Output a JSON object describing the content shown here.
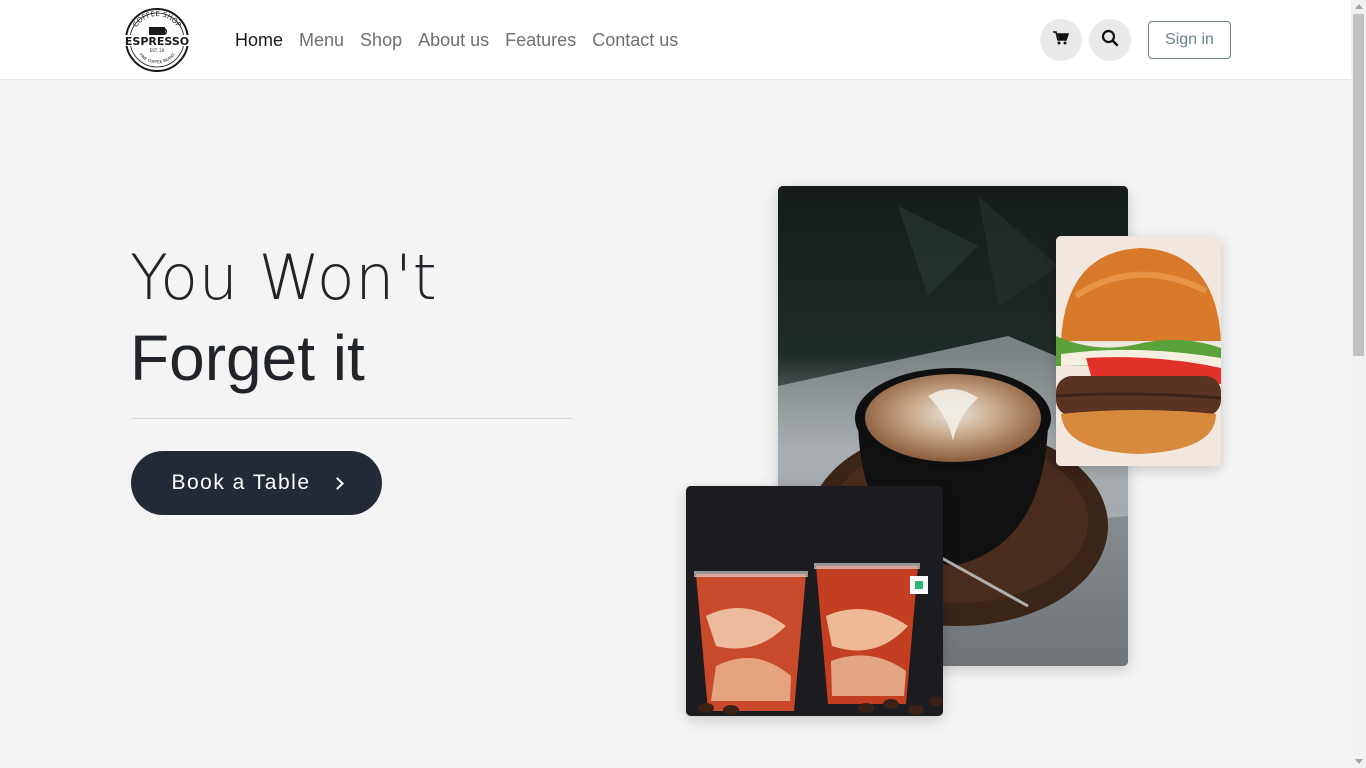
{
  "header": {
    "logo": {
      "top_text": "COFFEE SHOP",
      "main_text": "ESPRESSO",
      "small_text": "EST. 20",
      "bottom_text": "FINE COFFEE BEANS"
    },
    "nav": [
      {
        "label": "Home",
        "active": true
      },
      {
        "label": "Menu",
        "active": false
      },
      {
        "label": "Shop",
        "active": false
      },
      {
        "label": "About us",
        "active": false
      },
      {
        "label": "Features",
        "active": false
      },
      {
        "label": "Contact us",
        "active": false
      }
    ],
    "cart_icon": "cart-icon",
    "search_icon": "search-icon",
    "signin_label": "Sign in"
  },
  "hero": {
    "title_line1": "You Won't",
    "title_line2": "Forget it",
    "cta_label": "Book a Table",
    "cta_icon": "chevron-right-icon"
  },
  "images": [
    {
      "name": "latte-art-coffee-image"
    },
    {
      "name": "burger-image"
    },
    {
      "name": "iced-coffee-drinks-image"
    }
  ],
  "colors": {
    "background": "#f4f4f4",
    "header_bg": "#ffffff",
    "cta_bg": "#222a35",
    "signin_border": "#6c8189",
    "nav_active": "#1a1a1a",
    "nav_inactive": "#6f6f6f"
  }
}
